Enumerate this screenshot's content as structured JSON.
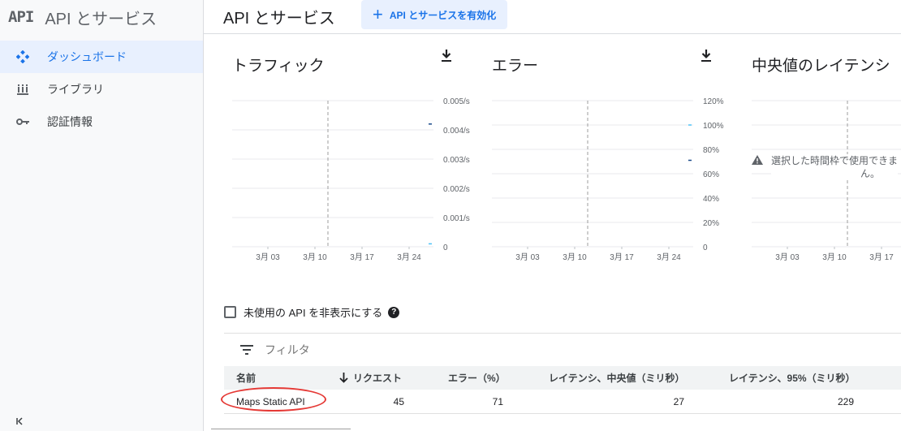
{
  "brand": {
    "logo": "API",
    "title": "API とサービス"
  },
  "sidebar": {
    "items": [
      {
        "label": "ダッシュボード",
        "icon": "dashboard-icon",
        "active": true
      },
      {
        "label": "ライブラリ",
        "icon": "library-icon",
        "active": false
      },
      {
        "label": "認証情報",
        "icon": "key-icon",
        "active": false
      }
    ],
    "collapse_icon": "collapse-sidebar-icon"
  },
  "header": {
    "title": "API とサービス",
    "enable_button": {
      "label": "API とサービスを有効化",
      "icon": "plus-icon"
    }
  },
  "charts": [
    {
      "title": "トラフィック",
      "y_ticks": [
        "0.005/s",
        "0.004/s",
        "0.003/s",
        "0.002/s",
        "0.001/s",
        "0"
      ],
      "x_ticks": [
        "3月 03",
        "3月 10",
        "3月 17",
        "3月 24"
      ],
      "download_icon": "download-icon"
    },
    {
      "title": "エラー",
      "y_ticks": [
        "120%",
        "100%",
        "80%",
        "60%",
        "40%",
        "20%",
        "0"
      ],
      "x_ticks": [
        "3月 03",
        "3月 10",
        "3月 17",
        "3月 24"
      ],
      "download_icon": "download-icon"
    },
    {
      "title": "中央値のレイテンシ",
      "x_ticks": [
        "3月 03",
        "3月 10",
        "3月 17"
      ],
      "no_data_line1": "選択した時間枠で使用できま",
      "no_data_line2": "ん。",
      "warning_icon": "warning-icon"
    }
  ],
  "chart_data": [
    {
      "type": "line",
      "title": "トラフィック",
      "ylim": [
        0,
        0.005
      ],
      "yunit": "/s",
      "categories": [
        "3月 03",
        "3月 10",
        "3月 17",
        "3月 24"
      ],
      "series": [
        {
          "x": [
            "3月 26",
            "3月 27"
          ],
          "values": [
            0.0042,
            0.0042
          ],
          "color": "#1a4a8a"
        },
        {
          "x": [
            "3月 26",
            "3月 27"
          ],
          "values": [
            0.0001,
            0.0001
          ],
          "color": "#4fc3f7"
        }
      ]
    },
    {
      "type": "line",
      "title": "エラー",
      "ylim": [
        0,
        120
      ],
      "yunit": "%",
      "categories": [
        "3月 03",
        "3月 10",
        "3月 17",
        "3月 24"
      ],
      "series": [
        {
          "x": [
            "3月 26",
            "3月 27"
          ],
          "values": [
            100,
            100
          ],
          "color": "#4fc3f7"
        },
        {
          "x": [
            "3月 26",
            "3月 27"
          ],
          "values": [
            71,
            71
          ],
          "color": "#1a4a8a"
        }
      ]
    }
  ],
  "filter": {
    "hide_unused_label": "未使用の API を非表示にする",
    "hide_unused_checked": false,
    "placeholder": "フィルタ",
    "filter_icon": "filter-icon",
    "help_icon": "help-icon"
  },
  "table": {
    "columns": {
      "name": "名前",
      "requests": "リクエスト",
      "errors": "エラー（%）",
      "latency_median": "レイテンシ、中央値（ミリ秒）",
      "latency_95": "レイテンシ、95%（ミリ秒）"
    },
    "sort_icon": "arrow-down-icon",
    "rows": [
      {
        "name": "Maps Static API",
        "requests": "45",
        "errors": "71",
        "latency_median": "27",
        "latency_95": "229"
      }
    ]
  }
}
